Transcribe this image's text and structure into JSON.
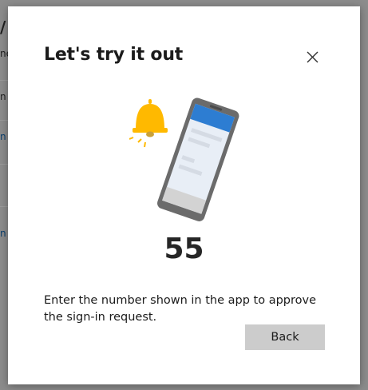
{
  "background": {
    "fragments": [
      "/",
      "ne",
      "n",
      "n",
      "n"
    ]
  },
  "dialog": {
    "title": "Let's try it out",
    "close_icon": "close-icon",
    "illustration": {
      "icons": [
        "bell-icon",
        "phone-icon"
      ],
      "colors": {
        "bell": "#FFB900",
        "phone_header": "#2D7DD2",
        "phone_body": "#E8EEF6",
        "phone_frame": "#6B6B6B"
      }
    },
    "number": "55",
    "instruction": "Enter the number shown in the app to approve the sign-in request.",
    "back_label": "Back"
  }
}
